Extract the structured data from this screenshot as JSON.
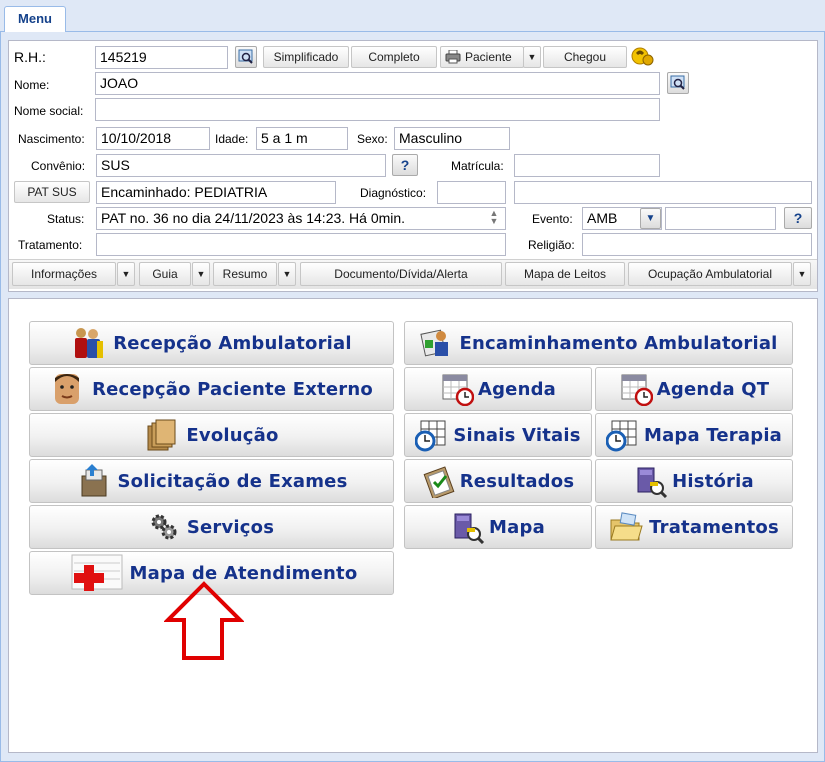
{
  "tab": {
    "label": "Menu"
  },
  "form": {
    "rh_label": "R.H.:",
    "rh_value": "145219",
    "btn_simplificado": "Simplificado",
    "btn_completo": "Completo",
    "btn_paciente": "Paciente",
    "btn_chegou": "Chegou",
    "nome_label": "Nome:",
    "nome_value": "JOAO",
    "nome_social_label": "Nome social:",
    "nome_social_value": "",
    "nascimento_label": "Nascimento:",
    "nascimento_value": "10/10/2018",
    "idade_label": "Idade:",
    "idade_value": "5 a 1 m",
    "sexo_label": "Sexo:",
    "sexo_value": "Masculino",
    "convenio_label": "Convênio:",
    "convenio_value": "SUS",
    "help_symbol": "?",
    "matricula_label": "Matrícula:",
    "matricula_value": "",
    "btn_pat_sus": "PAT SUS",
    "encaminhado_value": "Encaminhado: PEDIATRIA",
    "diagnostico_label": "Diagnóstico:",
    "diagnostico_value": "",
    "status_label": "Status:",
    "status_value": "PAT no. 36 no dia 24/11/2023  às  14:23. Há 0min.",
    "evento_label": "Evento:",
    "evento_value": "AMB",
    "tratamento_label": "Tratamento:",
    "tratamento_value": "",
    "religiao_label": "Religião:",
    "religiao_value": ""
  },
  "toolbar": {
    "informacoes": "Informações",
    "guia": "Guia",
    "resumo": "Resumo",
    "documento": "Documento/Dívida/Alerta",
    "mapa_leitos": "Mapa de Leitos",
    "ocupacao": "Ocupação Ambulatorial"
  },
  "menu": {
    "recepcao_ambulatorial": "Recepção Ambulatorial",
    "encaminhamento_ambulatorial": "Encaminhamento Ambulatorial",
    "recepcao_paciente_externo": "Recepção Paciente Externo",
    "agenda": "Agenda",
    "agenda_qt": "Agenda QT",
    "evolucao": "Evolução",
    "sinais_vitais": "Sinais Vitais",
    "mapa_terapia": "Mapa Terapia",
    "solicitacao_exames": "Solicitação de Exames",
    "resultados": "Resultados",
    "historia": "História",
    "servicos": "Serviços",
    "mapa": "Mapa",
    "tratamentos": "Tratamentos",
    "mapa_atendimento": "Mapa de Atendimento"
  },
  "colors": {
    "menu_text": "#15328b",
    "annotation_arrow": "#e00000",
    "panel_bg": "#dfe8f6"
  }
}
